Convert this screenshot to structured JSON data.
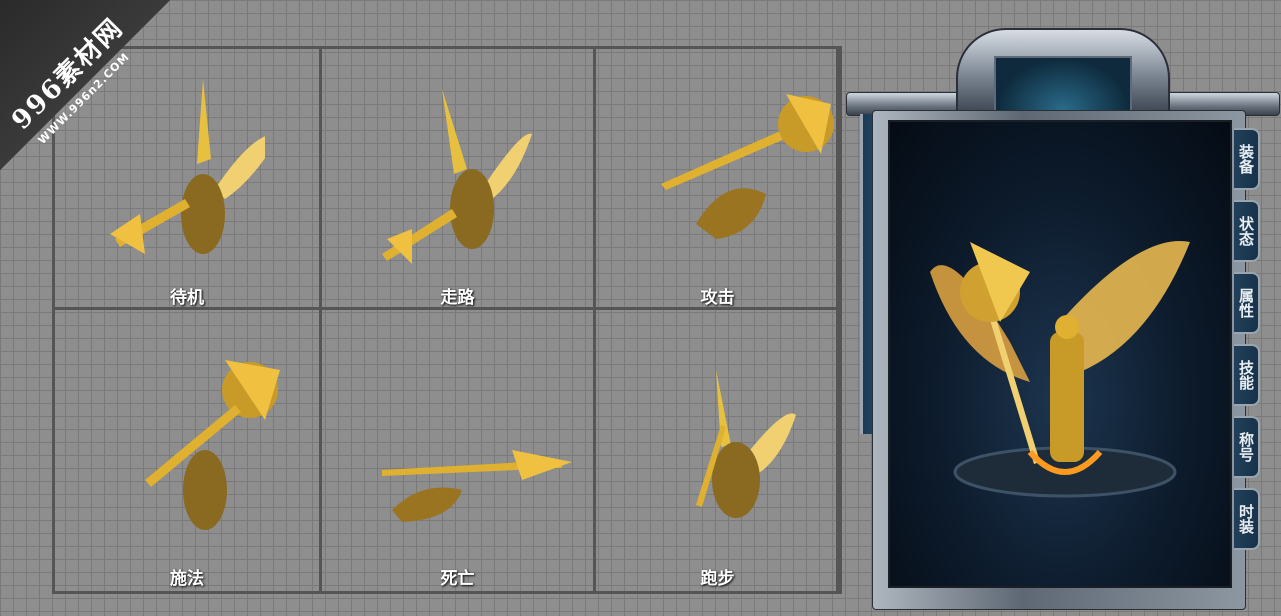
{
  "watermark": {
    "line1": "996素材网",
    "line2": "WWW.996n2.COM"
  },
  "animations": [
    {
      "label": "待机"
    },
    {
      "label": "走路"
    },
    {
      "label": "攻击"
    },
    {
      "label": "施法"
    },
    {
      "label": "死亡"
    },
    {
      "label": "跑步"
    }
  ],
  "panel": {
    "tabs": [
      {
        "label": "装备"
      },
      {
        "label": "状态"
      },
      {
        "label": "属性"
      },
      {
        "label": "技能"
      },
      {
        "label": "称号"
      },
      {
        "label": "时装"
      }
    ]
  },
  "colors": {
    "gold": "#e0b030",
    "panel_blue": "#17324a",
    "grid_line": "#555555"
  }
}
